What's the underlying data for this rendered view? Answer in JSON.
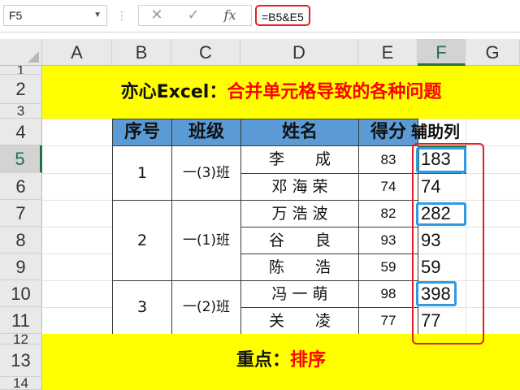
{
  "formula_bar": {
    "name_box": "F5",
    "cancel_icon": "✕",
    "enter_icon": "✓",
    "fx_icon": "fx",
    "formula": "=B5&E5"
  },
  "columns": [
    "A",
    "B",
    "C",
    "D",
    "E",
    "F",
    "G"
  ],
  "selected_column": "F",
  "rows": [
    "1",
    "2",
    "3",
    "4",
    "5",
    "6",
    "7",
    "8",
    "9",
    "10",
    "11",
    "12",
    "13",
    "14"
  ],
  "selected_row": "5",
  "title_banner": {
    "prefix": "亦心Excel：",
    "text": "合并单元格导致的各种问题"
  },
  "footer_banner": {
    "prefix": "重点：",
    "text": "排序"
  },
  "table": {
    "headers": {
      "index": "序号",
      "class": "班级",
      "name": "姓名",
      "score": "得分",
      "helper": "辅助列"
    },
    "groups": [
      {
        "index": "1",
        "class": "一(3)班",
        "rows": [
          {
            "name": "李　　成",
            "score": "83",
            "helper": "183"
          },
          {
            "name": "邓 海 荣",
            "score": "74",
            "helper": "74"
          }
        ]
      },
      {
        "index": "2",
        "class": "一(1)班",
        "rows": [
          {
            "name": "万 浩 波",
            "score": "82",
            "helper": "282"
          },
          {
            "name": "谷　　良",
            "score": "93",
            "helper": "93"
          },
          {
            "name": "陈　　浩",
            "score": "59",
            "helper": "59"
          }
        ]
      },
      {
        "index": "3",
        "class": "一(2)班",
        "rows": [
          {
            "name": "冯 一 萌",
            "score": "98",
            "helper": "398"
          },
          {
            "name": "关　　凌",
            "score": "77",
            "helper": "77"
          }
        ]
      }
    ]
  },
  "colors": {
    "banner_bg": "#ffff00",
    "header_bg": "#5b9bd5",
    "highlight_red": "#e81c1c",
    "highlight_blue": "#2f9be6",
    "excel_green": "#217346"
  }
}
